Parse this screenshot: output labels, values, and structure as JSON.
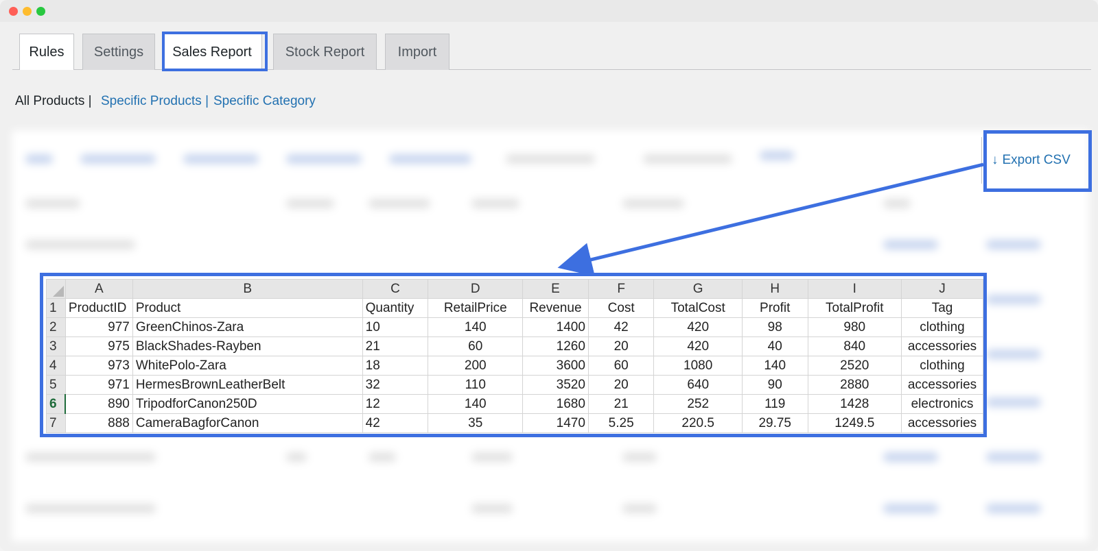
{
  "window": {
    "controls": [
      "close",
      "minimize",
      "maximize"
    ]
  },
  "tabs": [
    {
      "label": "Rules"
    },
    {
      "label": "Settings"
    },
    {
      "label": "Sales Report"
    },
    {
      "label": "Stock Report"
    },
    {
      "label": "Import"
    }
  ],
  "active_tab": "Sales Report",
  "subnav": {
    "current": "All Products |",
    "links": [
      "Specific Products |",
      "Specific Category"
    ]
  },
  "export": {
    "label": "Export CSV",
    "icon": "arrow-down-icon"
  },
  "highlight_color": "#3d6fe0",
  "spreadsheet": {
    "column_letters": [
      "A",
      "B",
      "C",
      "D",
      "E",
      "F",
      "G",
      "H",
      "I",
      "J"
    ],
    "row_numbers": [
      "1",
      "2",
      "3",
      "4",
      "5",
      "6",
      "7"
    ],
    "selected_row": "6",
    "headers": [
      "ProductID",
      "Product",
      "Quantity",
      "RetailPrice",
      "Revenue",
      "Cost",
      "TotalCost",
      "Profit",
      "TotalProfit",
      "Tag"
    ],
    "rows": [
      [
        "977",
        "GreenChinos-Zara",
        "10",
        "140",
        "1400",
        "42",
        "420",
        "98",
        "980",
        "clothing"
      ],
      [
        "975",
        "BlackShades-Rayben",
        "21",
        "60",
        "1260",
        "20",
        "420",
        "40",
        "840",
        "accessories"
      ],
      [
        "973",
        "WhitePolo-Zara",
        "18",
        "200",
        "3600",
        "60",
        "1080",
        "140",
        "2520",
        "clothing"
      ],
      [
        "971",
        "HermesBrownLeatherBelt",
        "32",
        "110",
        "3520",
        "20",
        "640",
        "90",
        "2880",
        "accessories"
      ],
      [
        "890",
        "TripodforCanon250D",
        "12",
        "140",
        "1680",
        "21",
        "252",
        "119",
        "1428",
        "electronics"
      ],
      [
        "888",
        "CameraBagforCanon",
        "42",
        "35",
        "1470",
        "5.25",
        "220.5",
        "29.75",
        "1249.5",
        "accessories"
      ]
    ]
  }
}
